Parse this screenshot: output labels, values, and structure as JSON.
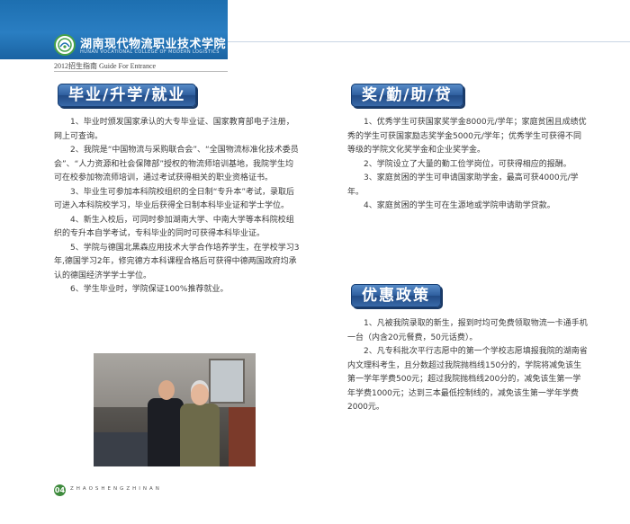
{
  "header": {
    "college_name": "湖南现代物流职业技术学院",
    "college_name_en": "HUNAN VOCATIONAL COLLEGE OF MODERN LOGISTICS",
    "guide": "2012招生指南  Guide For Entrance"
  },
  "sections": {
    "employment": {
      "title": "毕业/升学/就业",
      "paragraphs": [
        "1、毕业时颁发国家承认的大专毕业证、国家教育部电子注册，网上可查询。",
        "2、我院是“中国物流与采购联合会”、“全国物流标准化技术委员会”、“人力资源和社会保障部”授权的物流师培训基地，我院学生均可在校参加物流师培训，通过考试获得相关的职业资格证书。",
        "3、毕业生可参加本科院校组织的全日制“专升本”考试，录取后可进入本科院校学习，毕业后获得全日制本科毕业证和学士学位。",
        "4、新生入校后，可同时参加湖南大学、中南大学等本科院校组织的专升本自学考试，专科毕业的同时可获得本科毕业证。",
        "5、学院与德国北黑森应用技术大学合作培养学生，在学校学习3年,德国学习2年，修完德方本科课程合格后可获得中德两国政府均承认的德国经济学学士学位。",
        "6、学生毕业时，学院保证100%推荐就业。"
      ]
    },
    "scholarship": {
      "title": "奖/勤/助/贷",
      "paragraphs": [
        "1、优秀学生可获国家奖学金8000元/学年；家庭贫困且成绩优秀的学生可获国家励志奖学金5000元/学年；优秀学生可获得不同等级的学院文化奖学金和企业奖学金。",
        "2、学院设立了大量的勤工俭学岗位，可获得相应的报酬。",
        "3、家庭贫困的学生可申请国家助学金，最高可获4000元/学年。",
        "4、家庭贫困的学生可在生源地或学院申请助学贷款。"
      ]
    },
    "policy": {
      "title": "优惠政策",
      "paragraphs": [
        "1、凡被我院录取的新生，报到时均可免费领取物流一卡通手机一台（内含20元餐费，50元话费）。",
        "2、凡专科批次平行志愿中的第一个学校志愿填报我院的湖南省内文理科考生，且分数超过我院抛档线150分的，学院将减免该生第一学年学费500元；超过我院抛档线200分的，减免该生第一学年学费1000元；达到三本最低控制线的，减免该生第一学年学费2000元。"
      ]
    }
  },
  "footer": {
    "page_number": "04",
    "running_text": "ZHAOSHENGZHINAN"
  },
  "colors": {
    "header_blue": "#1d6fb0",
    "title_blue": "#2e5e9e",
    "logo_green": "#46a04a"
  }
}
